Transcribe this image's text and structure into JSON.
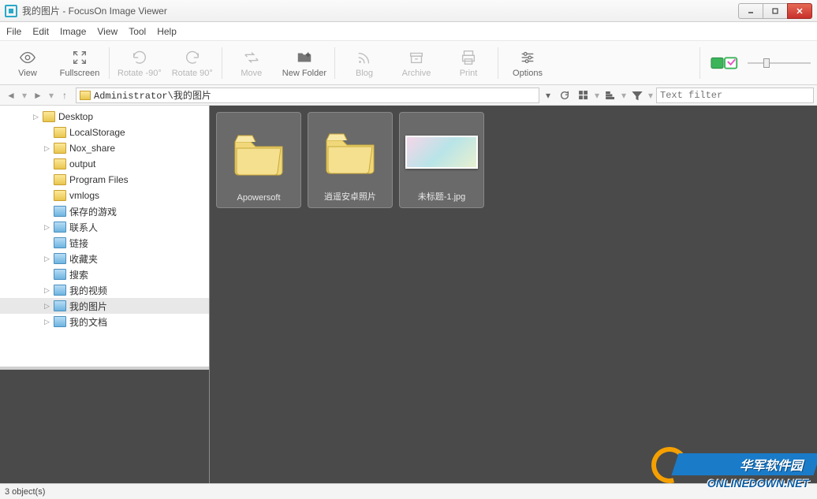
{
  "window": {
    "title": "我的图片 - FocusOn Image Viewer"
  },
  "menu": {
    "items": [
      "File",
      "Edit",
      "Image",
      "View",
      "Tool",
      "Help"
    ]
  },
  "toolbar": {
    "view": "View",
    "fullscreen": "Fullscreen",
    "rotate_neg90": "Rotate -90°",
    "rotate_90": "Rotate 90°",
    "move": "Move",
    "new_folder": "New Folder",
    "blog": "Blog",
    "archive": "Archive",
    "print": "Print",
    "options": "Options"
  },
  "address": {
    "path": "Administrator\\我的图片",
    "filter_placeholder": "Text filter"
  },
  "tree": {
    "items": [
      {
        "label": "Desktop",
        "indent": 3,
        "expandable": true,
        "icon": "folder"
      },
      {
        "label": "LocalStorage",
        "indent": 4,
        "expandable": false,
        "icon": "folder"
      },
      {
        "label": "Nox_share",
        "indent": 4,
        "expandable": true,
        "icon": "folder"
      },
      {
        "label": "output",
        "indent": 4,
        "expandable": false,
        "icon": "folder"
      },
      {
        "label": "Program Files",
        "indent": 4,
        "expandable": false,
        "icon": "folder"
      },
      {
        "label": "vmlogs",
        "indent": 4,
        "expandable": false,
        "icon": "folder"
      },
      {
        "label": "保存的游戏",
        "indent": 4,
        "expandable": false,
        "icon": "special"
      },
      {
        "label": "联系人",
        "indent": 4,
        "expandable": true,
        "icon": "special"
      },
      {
        "label": "链接",
        "indent": 4,
        "expandable": false,
        "icon": "special"
      },
      {
        "label": "收藏夹",
        "indent": 4,
        "expandable": true,
        "icon": "special"
      },
      {
        "label": "搜索",
        "indent": 4,
        "expandable": false,
        "icon": "special"
      },
      {
        "label": "我的视频",
        "indent": 4,
        "expandable": true,
        "icon": "special"
      },
      {
        "label": "我的图片",
        "indent": 4,
        "expandable": true,
        "icon": "special",
        "selected": true
      },
      {
        "label": "我的文档",
        "indent": 4,
        "expandable": true,
        "icon": "special"
      }
    ]
  },
  "content": {
    "items": [
      {
        "type": "folder",
        "name": "Apowersoft"
      },
      {
        "type": "folder",
        "name": "逍遥安卓照片"
      },
      {
        "type": "image",
        "name": "未标题-1.jpg"
      }
    ]
  },
  "status": {
    "text": "3 object(s)"
  },
  "watermark": {
    "line1": "华军软件园",
    "line2": "ONLINEDOWN.NET"
  }
}
